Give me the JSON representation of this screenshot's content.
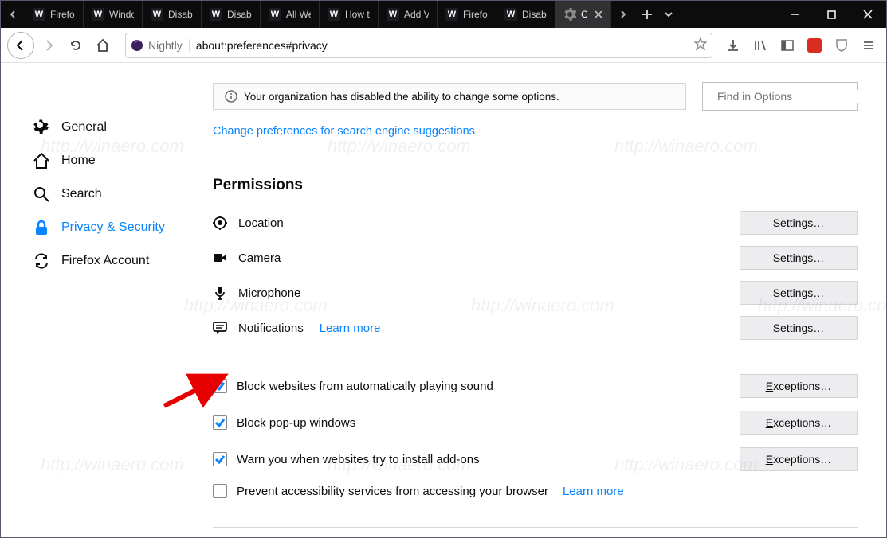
{
  "tabs": [
    {
      "label": "Firefo"
    },
    {
      "label": "Windo"
    },
    {
      "label": "Disabl"
    },
    {
      "label": "Disabl"
    },
    {
      "label": "All We"
    },
    {
      "label": "How t"
    },
    {
      "label": "Add V"
    },
    {
      "label": "Firefo"
    },
    {
      "label": "Disabl"
    }
  ],
  "active_tab": {
    "label": "Op"
  },
  "identity_label": "Nightly",
  "url": "about:preferences#privacy",
  "notice": "Your organization has disabled the ability to change some options.",
  "search_placeholder": "Find in Options",
  "sidebar": {
    "items": [
      {
        "label": "General"
      },
      {
        "label": "Home"
      },
      {
        "label": "Search"
      },
      {
        "label": "Privacy & Security"
      },
      {
        "label": "Firefox Account"
      }
    ]
  },
  "search_engine_link": "Change preferences for search engine suggestions",
  "permissions": {
    "title": "Permissions",
    "rows": [
      {
        "label": "Location",
        "button": "Settings…"
      },
      {
        "label": "Camera",
        "button": "Settings…"
      },
      {
        "label": "Microphone",
        "button": "Settings…"
      },
      {
        "label": "Notifications",
        "button": "Settings…",
        "link": "Learn more"
      }
    ]
  },
  "checks": [
    {
      "label": "Block websites from automatically playing sound",
      "checked": true,
      "button": "Exceptions…"
    },
    {
      "label": "Block pop-up windows",
      "checked": true,
      "button": "Exceptions…"
    },
    {
      "label": "Warn you when websites try to install add-ons",
      "checked": true,
      "button": "Exceptions…"
    },
    {
      "label": "Prevent accessibility services from accessing your browser",
      "checked": false,
      "link": "Learn more"
    }
  ],
  "watermark": "http://winaero.com"
}
